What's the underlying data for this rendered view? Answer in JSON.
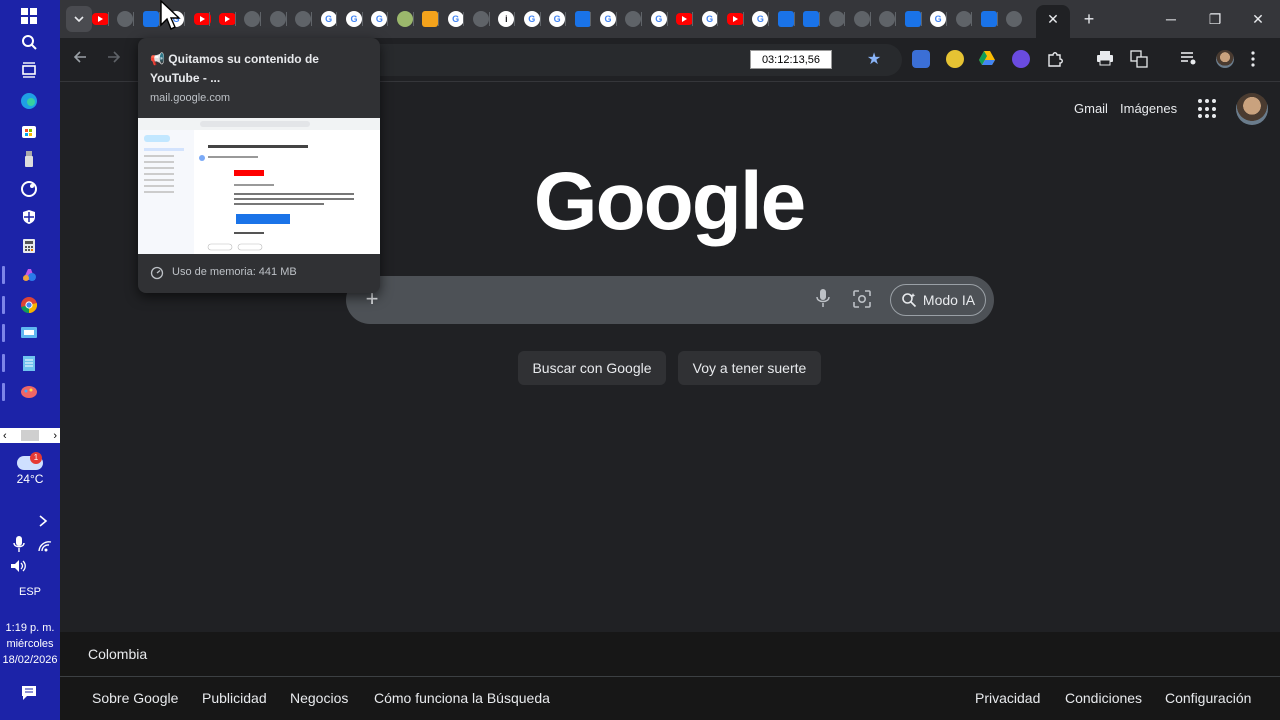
{
  "taskbar": {
    "weather_temp": "24°C",
    "weather_badge": "1",
    "language": "ESP",
    "time": "1:19 p. m.",
    "day": "miércoles",
    "date": "18/02/2026"
  },
  "browser": {
    "clock_overlay": "03:12:13,56",
    "window_controls": {
      "minimize": "─",
      "restore": "❐",
      "close": "✕"
    },
    "new_tab": "+",
    "tab_close": "✕"
  },
  "hovercard": {
    "title": "📢 Quitamos su contenido de YouTube - ...",
    "domain": "mail.google.com",
    "memory": "Uso de memoria: 441 MB"
  },
  "page": {
    "logo": "Google",
    "gmail_link": "Gmail",
    "images_link": "Imágenes",
    "ai_mode_label": "Modo IA",
    "search_button": "Buscar con Google",
    "lucky_button": "Voy a tener suerte"
  },
  "footer": {
    "country": "Colombia",
    "left_links": [
      "Sobre Google",
      "Publicidad",
      "Negocios",
      "Cómo funciona la Búsqueda"
    ],
    "right_links": [
      "Privacidad",
      "Condiciones",
      "Configuración"
    ]
  }
}
